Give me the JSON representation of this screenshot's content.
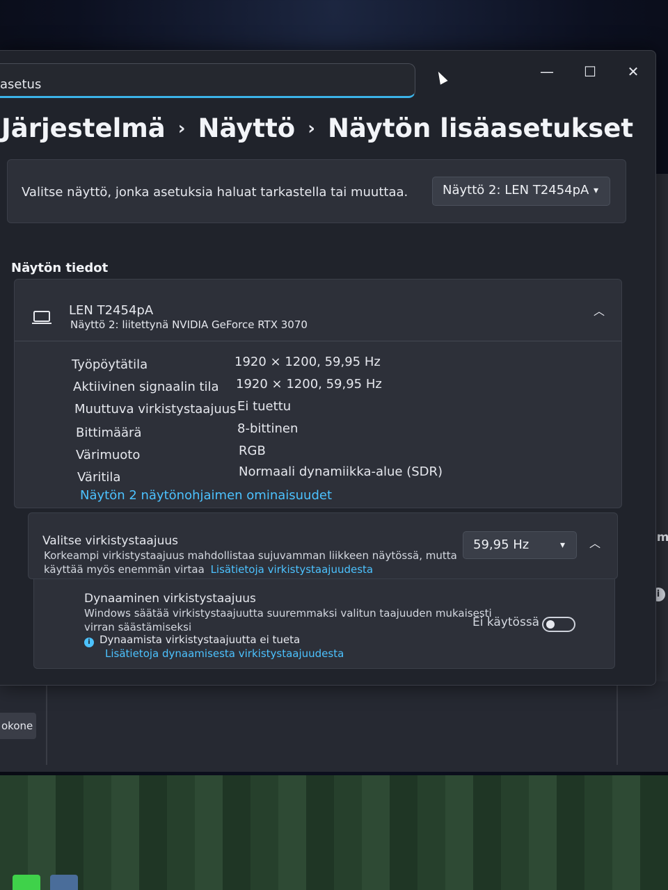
{
  "titlebar": {
    "search_text": "asetus",
    "minimize": "—",
    "maximize": "☐",
    "close": "✕"
  },
  "breadcrumb": {
    "items": [
      "Järjestelmä",
      "Näyttö",
      "Näytön lisäasetukset"
    ],
    "separator": "›"
  },
  "display_select": {
    "label": "Valitse näyttö, jonka asetuksia haluat tarkastella tai muuttaa.",
    "value": "Näyttö 2: LEN T2454pA"
  },
  "section_title": "Näytön tiedot",
  "display_info": {
    "name": "LEN T2454pA",
    "subtitle": "Näyttö 2: liitettynä NVIDIA GeForce RTX 3070",
    "rows": [
      {
        "label": "Työpöytätila",
        "value": "1920 × 1200, 59,95 Hz"
      },
      {
        "label": "Aktiivinen signaalin tila",
        "value": "1920 × 1200, 59,95 Hz"
      },
      {
        "label": "Muuttuva virkistystaajuus",
        "value": "Ei tuettu"
      },
      {
        "label": "Bittimäärä",
        "value": "8-bittinen"
      },
      {
        "label": "Värimuoto",
        "value": "RGB"
      },
      {
        "label": "Väritila",
        "value": "Normaali dynamiikka-alue (SDR)"
      }
    ],
    "adapter_link": "Näytön 2 näytönohjaimen ominaisuudet"
  },
  "refresh_rate": {
    "title": "Valitse virkistystaajuus",
    "desc_line1": "Korkeampi virkistystaajuus mahdollistaa sujuvamman liikkeen näytössä, mutta",
    "desc_line2": "käyttää myös enemmän virtaa",
    "link": "Lisätietoja virkistystaajuudesta",
    "value": "59,95 Hz"
  },
  "dynamic_refresh": {
    "title": "Dynaaminen virkistystaajuus",
    "desc_line1": "Windows säätää virkistystaajuutta suuremmaksi valitun taajuuden mukaisesti",
    "desc_line2": "virran säästämiseksi",
    "note": "Dynaamista virkistystaajuutta ei tueta",
    "link": "Lisätietoja dynaamisesta virkistystaajuudesta",
    "state_label": "Ei käytössä"
  },
  "background": {
    "right_window_text": "Täm",
    "left_button_text": "okone"
  },
  "colors": {
    "accent": "#4cc2ff",
    "window_bg": "#20232b",
    "card_bg": "#2d3039"
  }
}
